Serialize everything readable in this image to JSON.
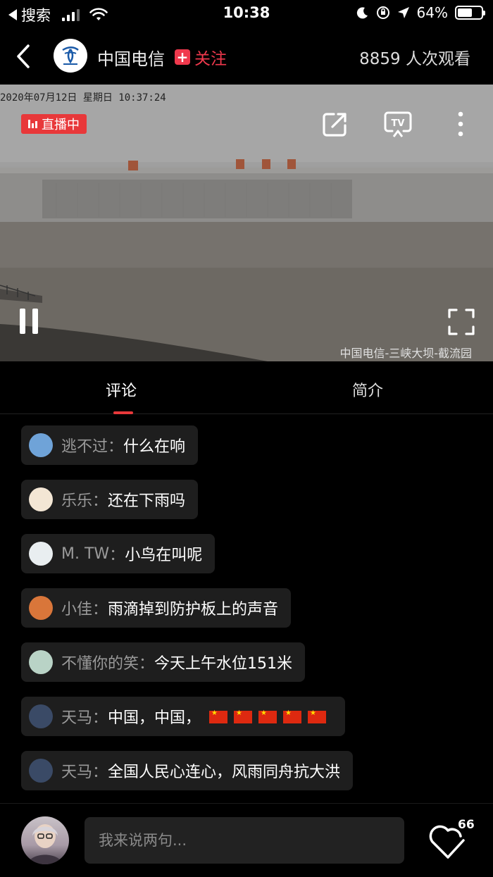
{
  "status_bar": {
    "back_app": "搜索",
    "time": "10:38",
    "battery_text": "64%",
    "battery_level": 0.64
  },
  "header": {
    "channel_name": "中国电信",
    "follow_label": "关注",
    "viewer_count": "8859 人次观看"
  },
  "video": {
    "timestamp": "2020年07月12日  星期日  10:37:24",
    "live_label": "直播中",
    "watermark": "中国电信-三峡大坝-截流园"
  },
  "tabs": {
    "comments": "评论",
    "intro": "简介"
  },
  "comments": [
    {
      "user": "逃不过",
      "text": "什么在响",
      "avatar_color": "#6fa3d8"
    },
    {
      "user": "乐乐",
      "text": "还在下雨吗",
      "avatar_color": "#f3e6d4"
    },
    {
      "user": "M. TW",
      "text": "小鸟在叫呢",
      "avatar_color": "#e9eef0"
    },
    {
      "user": "小佳",
      "text": "雨滴掉到防护板上的声音",
      "avatar_color": "#d9763a"
    },
    {
      "user": "不懂你的笑",
      "text": "今天上午水位151米",
      "avatar_color": "#b9d3c6"
    },
    {
      "user": "天马",
      "text": "中国，中国，",
      "flags": 5,
      "avatar_color": "#3a4a66"
    },
    {
      "user": "天马",
      "text": "全国人民心连心，风雨同舟抗大洪",
      "avatar_color": "#3a4a66"
    }
  ],
  "comment_separator": "：",
  "bottom": {
    "input_placeholder": "我来说两句...",
    "like_count": "66"
  }
}
